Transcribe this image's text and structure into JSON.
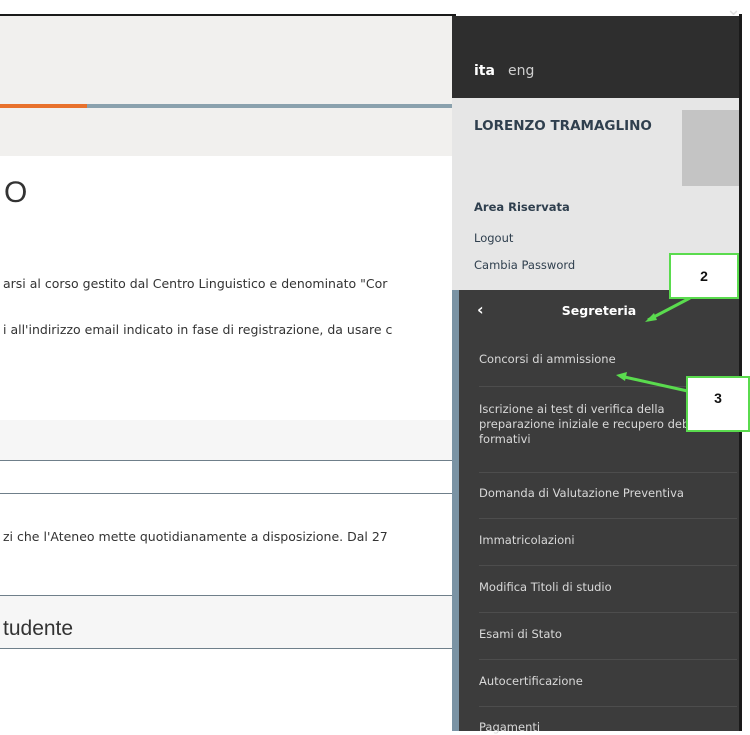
{
  "main": {
    "title_fragment": "O",
    "para1": "arsi al corso gestito dal Centro Linguistico e denominato \"Cor",
    "para2": "i all'indirizzo email indicato in fase di registrazione, da usare c",
    "para3": "zi che l'Ateneo mette quotidianamente a disposizione. Dal 27",
    "section_title": "tudente",
    "progress_fraction": 0.19
  },
  "panel": {
    "languages": [
      "ita",
      "eng"
    ],
    "active_language": "ita",
    "user_name": "LORENZO TRAMAGLINO",
    "area_label": "Area Riservata",
    "links": [
      "Logout",
      "Cambia Password"
    ],
    "menu_title": "Segreteria",
    "menu_items": [
      "Concorsi di ammissione",
      "Iscrizione ai test di verifica della preparazione iniziale e recupero debiti formativi",
      "Domanda di Valutazione Preventiva",
      "Immatricolazioni",
      "Modifica Titoli di studio",
      "Esami di Stato",
      "Autocertificazione",
      "Pagamenti"
    ]
  },
  "callouts": [
    "2",
    "3"
  ],
  "colors": {
    "accent_orange": "#e8712c",
    "callout_green": "#5adb4e",
    "menu_bg": "#3c3c3c",
    "lang_bar_bg": "#2e2e2e"
  }
}
